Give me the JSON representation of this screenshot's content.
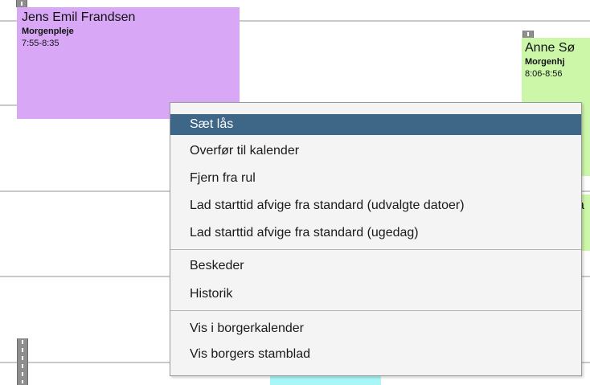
{
  "calendar": {
    "events": [
      {
        "name": "Jens Emil Frandsen",
        "service": "Morgenpleje",
        "time": "7:55-8:35"
      },
      {
        "name": "Anne Sø",
        "service": "Morgenhj",
        "time": "8:06-8:56"
      }
    ],
    "fragments": {
      "partial_a": "a",
      "partial_b": "e"
    },
    "colors": {
      "purple": "#d8a8f7",
      "green": "#ccf7a8",
      "cyan": "#a8f7f7",
      "lock_grey": "#8e8e8e"
    }
  },
  "context_menu": {
    "items": [
      {
        "label": "Sæt lås",
        "highlighted": true
      },
      {
        "label": "Overfør til kalender"
      },
      {
        "label": "Fjern fra rul"
      },
      {
        "label": "Lad starttid afvige fra standard (udvalgte datoer)"
      },
      {
        "label": "Lad starttid afvige fra standard (ugedag)"
      },
      {
        "label": "Beskeder"
      },
      {
        "label": "Historik"
      },
      {
        "label": "Vis i borgerkalender"
      },
      {
        "label": "Vis borgers stamblad"
      }
    ],
    "highlight_color": "#3d6687"
  }
}
